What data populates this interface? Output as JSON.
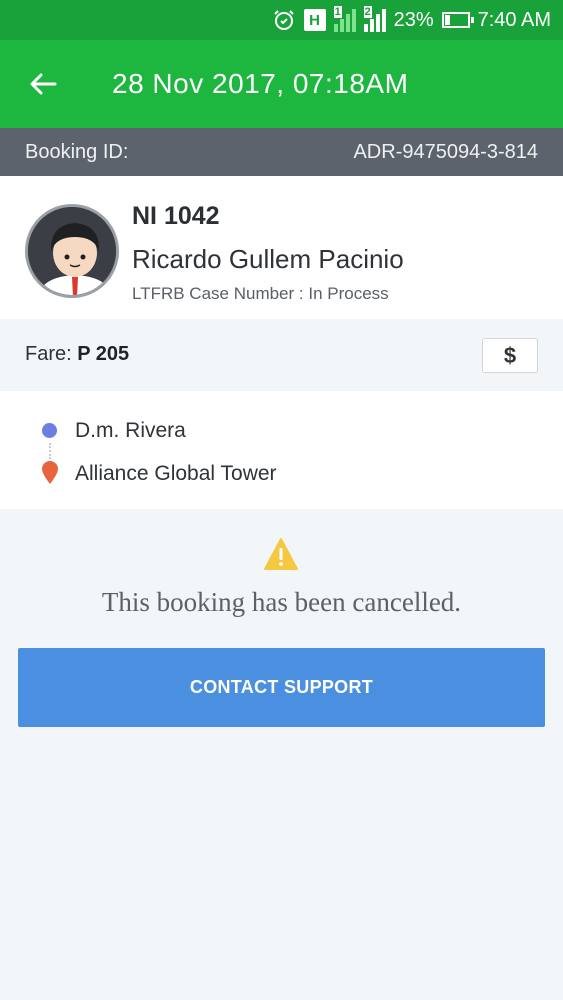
{
  "status_bar": {
    "h_indicator": "H",
    "sim1": "1",
    "sim2": "2",
    "battery_percent": "23%",
    "battery_level": 0.23,
    "time": "7:40 AM"
  },
  "header": {
    "title": "28 Nov 2017, 07:18AM",
    "back_icon": "arrow-left-icon"
  },
  "booking": {
    "label": "Booking ID:",
    "id": "ADR-9475094-3-814"
  },
  "driver": {
    "plate": "NI 1042",
    "name": "Ricardo Gullem Pacinio",
    "case_number": "LTFRB Case Number : In Process"
  },
  "fare": {
    "label": "Fare:",
    "value": "P 205",
    "payment_icon": "$"
  },
  "route": {
    "pickup": "D.m. Rivera",
    "dropoff": "Alliance Global Tower"
  },
  "cancellation": {
    "message": "This booking has been cancelled.",
    "button_label": "CONTACT SUPPORT"
  },
  "colors": {
    "status_bar": "#19a23a",
    "app_bar": "#1db73f",
    "booking_bar": "#5d636c",
    "pickup_dot": "#6b7fe0",
    "dropoff_pin": "#e8643c",
    "warning": "#f5c842",
    "support_button": "#4a8fe0"
  }
}
